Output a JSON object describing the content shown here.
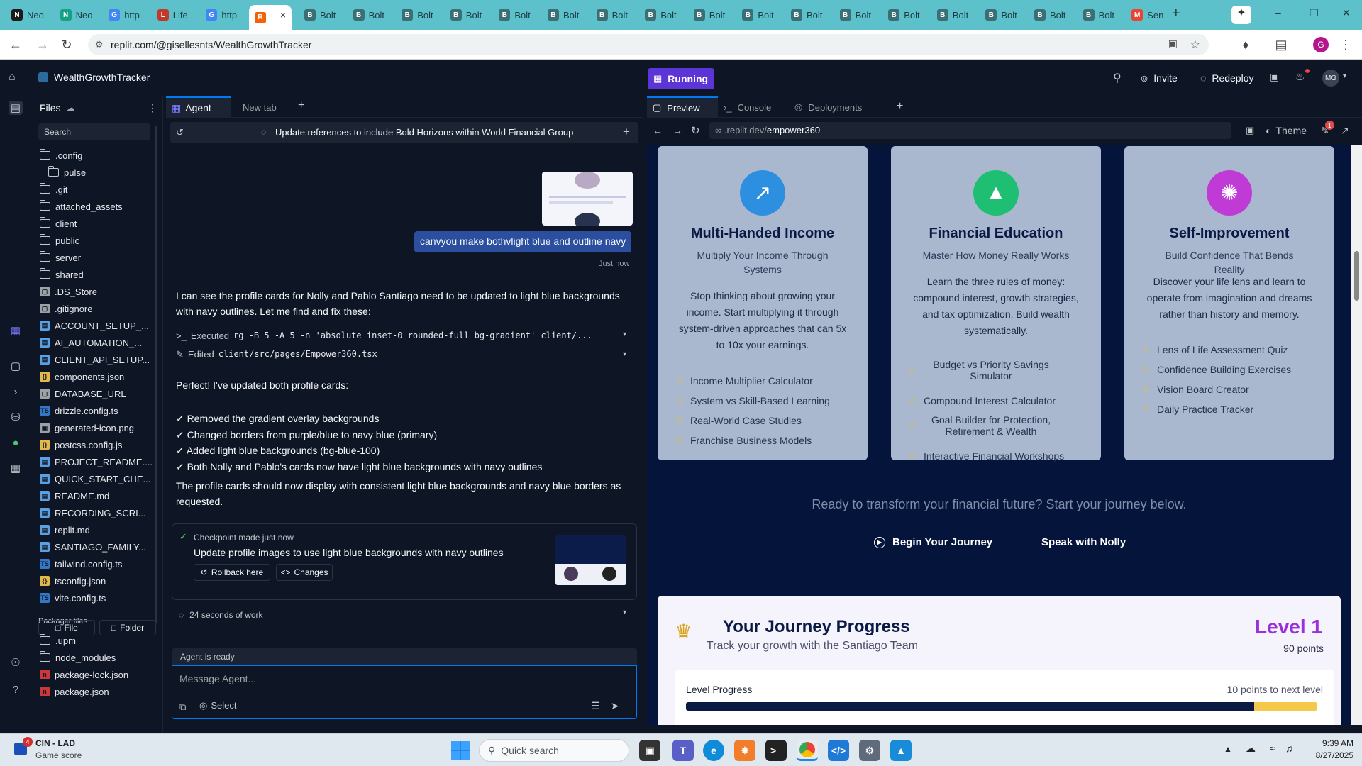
{
  "browser": {
    "tabs": [
      {
        "label": "Neo",
        "fav": "N",
        "color": "#1b1b1b"
      },
      {
        "label": "Neo",
        "fav": "N",
        "color": "#16a085"
      },
      {
        "label": "http",
        "fav": "G",
        "color": "#4285f4"
      },
      {
        "label": "Life",
        "fav": "L",
        "color": "#c0392b"
      },
      {
        "label": "http",
        "fav": "G",
        "color": "#4285f4"
      },
      {
        "label": "",
        "fav": "R",
        "color": "#f26207"
      },
      {
        "label": "Bolt",
        "fav": "B",
        "color": "#3b6f75"
      },
      {
        "label": "Bolt",
        "fav": "B",
        "color": "#3b6f75"
      },
      {
        "label": "Bolt",
        "fav": "B",
        "color": "#3b6f75"
      },
      {
        "label": "Bolt",
        "fav": "B",
        "color": "#3b6f75"
      },
      {
        "label": "Bolt",
        "fav": "B",
        "color": "#3b6f75"
      },
      {
        "label": "Bolt",
        "fav": "B",
        "color": "#3b6f75"
      },
      {
        "label": "Bolt",
        "fav": "B",
        "color": "#3b6f75"
      },
      {
        "label": "Bolt",
        "fav": "B",
        "color": "#3b6f75"
      },
      {
        "label": "Bolt",
        "fav": "B",
        "color": "#3b6f75"
      },
      {
        "label": "Bolt",
        "fav": "B",
        "color": "#3b6f75"
      },
      {
        "label": "Bolt",
        "fav": "B",
        "color": "#3b6f75"
      },
      {
        "label": "Bolt",
        "fav": "B",
        "color": "#3b6f75"
      },
      {
        "label": "Bolt",
        "fav": "B",
        "color": "#3b6f75"
      },
      {
        "label": "Bolt",
        "fav": "B",
        "color": "#3b6f75"
      },
      {
        "label": "Bolt",
        "fav": "B",
        "color": "#3b6f75"
      },
      {
        "label": "Bolt",
        "fav": "B",
        "color": "#3b6f75"
      },
      {
        "label": "Bolt",
        "fav": "B",
        "color": "#3b6f75"
      },
      {
        "label": "Sen",
        "fav": "M",
        "color": "#ea4335"
      }
    ],
    "url": "replit.com/@gisellesnts/WealthGrowthTracker",
    "profile_initial": "G"
  },
  "replit": {
    "project_name": "WealthGrowthTracker",
    "run_label": "Running",
    "invite_label": "Invite",
    "redeploy_label": "Redeploy",
    "avatar_initials": "MG"
  },
  "files": {
    "title": "Files",
    "search_placeholder": "Search",
    "items": [
      {
        "name": ".config",
        "type": "folder",
        "indent": 0
      },
      {
        "name": "pulse",
        "type": "folder",
        "indent": 1
      },
      {
        "name": ".git",
        "type": "folder",
        "indent": 0
      },
      {
        "name": "attached_assets",
        "type": "folder",
        "indent": 0
      },
      {
        "name": "client",
        "type": "folder",
        "indent": 0
      },
      {
        "name": "public",
        "type": "folder",
        "indent": 0
      },
      {
        "name": "server",
        "type": "folder",
        "indent": 0
      },
      {
        "name": "shared",
        "type": "folder",
        "indent": 0
      },
      {
        "name": ".DS_Store",
        "type": "file",
        "indent": 0
      },
      {
        "name": ".gitignore",
        "type": "file",
        "indent": 0
      },
      {
        "name": "ACCOUNT_SETUP_...",
        "type": "md",
        "indent": 0
      },
      {
        "name": "AI_AUTOMATION_...",
        "type": "md",
        "indent": 0
      },
      {
        "name": "CLIENT_API_SETUP...",
        "type": "md",
        "indent": 0
      },
      {
        "name": "components.json",
        "type": "json",
        "indent": 0
      },
      {
        "name": "DATABASE_URL",
        "type": "file",
        "indent": 0
      },
      {
        "name": "drizzle.config.ts",
        "type": "ts",
        "indent": 0
      },
      {
        "name": "generated-icon.png",
        "type": "img",
        "indent": 0
      },
      {
        "name": "postcss.config.js",
        "type": "json",
        "indent": 0
      },
      {
        "name": "PROJECT_README....",
        "type": "md",
        "indent": 0
      },
      {
        "name": "QUICK_START_CHE...",
        "type": "md",
        "indent": 0
      },
      {
        "name": "README.md",
        "type": "md",
        "indent": 0
      },
      {
        "name": "RECORDING_SCRI...",
        "type": "md",
        "indent": 0
      },
      {
        "name": "replit.md",
        "type": "md",
        "indent": 0
      },
      {
        "name": "SANTIAGO_FAMILY...",
        "type": "md",
        "indent": 0
      },
      {
        "name": "tailwind.config.ts",
        "type": "ts",
        "indent": 0
      },
      {
        "name": "tsconfig.json",
        "type": "json",
        "indent": 0
      },
      {
        "name": "vite.config.ts",
        "type": "ts",
        "indent": 0
      }
    ],
    "packager_title": "Packager files",
    "packager_items": [
      {
        "name": ".upm",
        "type": "folder"
      },
      {
        "name": "node_modules",
        "type": "folder"
      },
      {
        "name": "package-lock.json",
        "type": "npm"
      },
      {
        "name": "package.json",
        "type": "npm"
      }
    ],
    "new_file_label": "File",
    "new_folder_label": "Folder"
  },
  "agent": {
    "tab_agent": "Agent",
    "tab_new": "New tab",
    "header_title": "Update references to include Bold Horizons within World Financial Group",
    "user_message": "canvyou make bothvlight blue and outline navy",
    "user_time": "Just now",
    "reply_intro": "I can see the profile cards for Nolly and Pablo Santiago need to be updated to light blue backgrounds with navy outlines. Let me find and fix these:",
    "executed_label": "Executed",
    "executed_cmd": "rg -B 5 -A 5 -n 'absolute inset-0 rounded-full bg-gradient' client/...",
    "edited_label": "Edited",
    "edited_file": "client/src/pages/Empower360.tsx",
    "perfect": "Perfect! I've updated both profile cards:",
    "checks": [
      "✓ Removed the gradient overlay backgrounds",
      "✓ Changed borders from purple/blue to navy blue (primary)",
      "✓ Added light blue backgrounds (bg-blue-100)",
      "✓ Both Nolly and Pablo's cards now have light blue backgrounds with navy outlines"
    ],
    "closing": "The profile cards should now display with consistent light blue backgrounds and navy blue borders as requested.",
    "checkpoint_title": "Checkpoint made just now",
    "checkpoint_desc": "Update profile images to use light blue backgrounds with navy outlines",
    "rollback_label": "Rollback here",
    "changes_label": "Changes",
    "work_time": "24 seconds of work",
    "status": "Agent is ready",
    "input_placeholder": "Message Agent...",
    "select_label": "Select"
  },
  "preview": {
    "tabs": [
      "Preview",
      "Console",
      "Deployments"
    ],
    "url_prefix": ".replit.dev/",
    "url_path": "empower360",
    "theme_label": "Theme",
    "notif_count": "1",
    "cards": [
      {
        "title": "Multi-Handed Income",
        "subtitle": "Multiply Your Income Through Systems",
        "desc": "Stop thinking about growing your income. Start multiplying it through system-driven approaches that can 5x to 10x your earnings.",
        "icon": "trending-up-icon",
        "color": "#2d8fe0",
        "features": [
          "Income Multiplier Calculator",
          "System vs Skill-Based Learning",
          "Real-World Case Studies",
          "Franchise Business Models"
        ]
      },
      {
        "title": "Financial Education",
        "subtitle": "Master How Money Really Works",
        "desc": "Learn the three rules of money: compound interest, growth strategies, and tax optimization. Build wealth systematically.",
        "icon": "graduation-cap-icon",
        "color": "#1fbf73",
        "features": [
          "Budget vs Priority Savings Simulator",
          "Compound Interest Calculator",
          "Goal Builder for Protection, Retirement & Wealth",
          "Interactive Financial Workshops"
        ]
      },
      {
        "title": "Self-Improvement",
        "subtitle": "Build Confidence That Bends Reality",
        "desc": "Discover your life lens and learn to operate from imagination and dreams rather than history and memory.",
        "icon": "brain-icon",
        "color": "#c03ad6",
        "features": [
          "Lens of Life Assessment Quiz",
          "Confidence Building Exercises",
          "Vision Board Creator",
          "Daily Practice Tracker"
        ]
      }
    ],
    "cta_text": "Ready to transform your financial future? Start your journey below.",
    "begin_label": "Begin Your Journey",
    "speak_label": "Speak with Nolly",
    "progress": {
      "title": "Your Journey Progress",
      "subtitle": "Track your growth with the Santiago Team",
      "level": "Level 1",
      "points": "90 points",
      "bar_label": "Level Progress",
      "next_label": "10 points to next level",
      "fraction": 0.9
    }
  },
  "taskbar": {
    "game_title": "CIN - LAD",
    "game_sub": "Game score",
    "badge": "4",
    "search_placeholder": "Quick search",
    "time": "9:39 AM",
    "date": "8/27/2025"
  }
}
